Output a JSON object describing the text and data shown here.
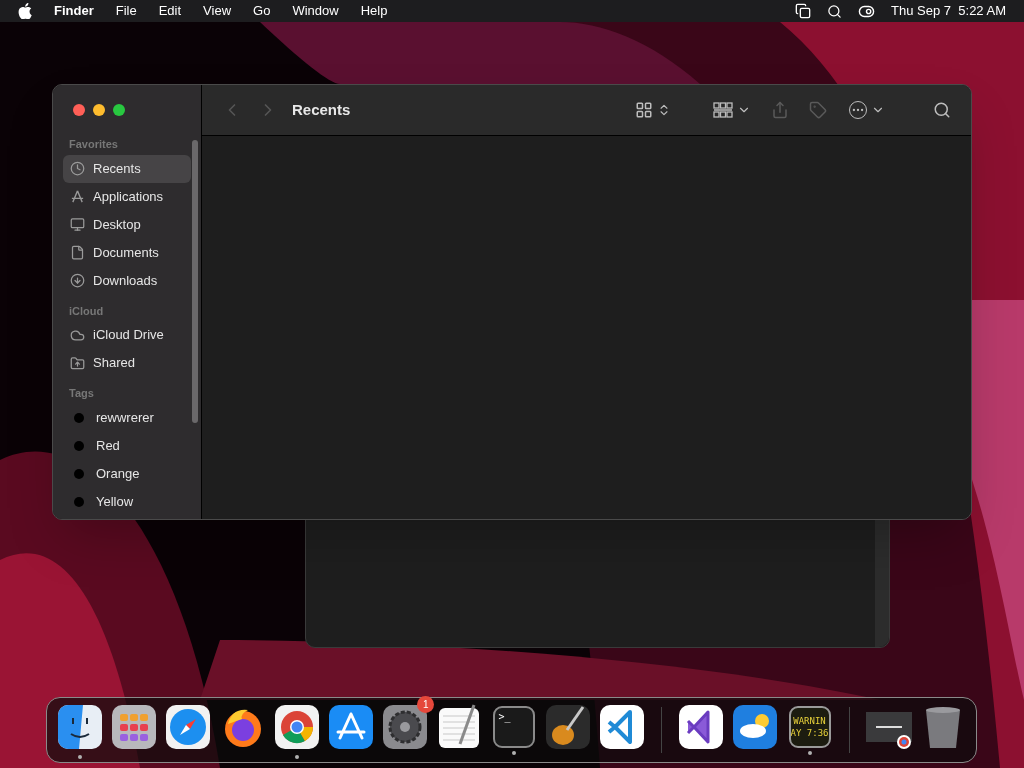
{
  "menu_bar": {
    "app_name": "Finder",
    "menus": [
      "File",
      "Edit",
      "View",
      "Go",
      "Window",
      "Help"
    ],
    "clock": "Thu Sep 7  5:22 AM"
  },
  "window": {
    "title": "Recents",
    "back_disabled": true,
    "forward_disabled": true,
    "toolbar": [
      {
        "kind": "icon-view",
        "disabled": false
      },
      {
        "kind": "group",
        "disabled": false
      },
      {
        "kind": "share",
        "disabled": true
      },
      {
        "kind": "tag",
        "disabled": true
      },
      {
        "kind": "more",
        "disabled": false
      },
      {
        "kind": "search",
        "disabled": false
      }
    ],
    "sidebar": [
      {
        "heading": "Favorites",
        "items": [
          {
            "label": "Recents",
            "kind": "clock",
            "selected": true
          },
          {
            "label": "Applications",
            "kind": "apps",
            "selected": false
          },
          {
            "label": "Desktop",
            "kind": "desktop",
            "selected": false
          },
          {
            "label": "Documents",
            "kind": "document",
            "selected": false
          },
          {
            "label": "Downloads",
            "kind": "download",
            "selected": false
          }
        ]
      },
      {
        "heading": "iCloud",
        "items": [
          {
            "label": "iCloud Drive",
            "kind": "cloud",
            "selected": false
          },
          {
            "label": "Shared",
            "kind": "shared",
            "selected": false
          }
        ]
      },
      {
        "heading": "Tags",
        "items": [
          {
            "label": "rewwrerer",
            "kind": "tag",
            "selected": false
          },
          {
            "label": "Red",
            "kind": "tag",
            "selected": false
          },
          {
            "label": "Orange",
            "kind": "tag",
            "selected": false
          },
          {
            "label": "Yellow",
            "kind": "tag",
            "selected": false
          }
        ]
      }
    ]
  },
  "dock": {
    "groups": [
      [
        {
          "kind": "finder",
          "running": true
        },
        {
          "kind": "launchpad",
          "running": false
        },
        {
          "kind": "safari",
          "running": false
        },
        {
          "kind": "firefox",
          "running": false
        },
        {
          "kind": "chrome",
          "running": true
        },
        {
          "kind": "appstore",
          "running": false
        },
        {
          "kind": "settings",
          "running": false,
          "badge": "1"
        },
        {
          "kind": "textedit",
          "running": false
        },
        {
          "kind": "terminal",
          "running": true,
          "prompt": ">_"
        },
        {
          "kind": "garageband",
          "running": false
        },
        {
          "kind": "vscode",
          "running": false
        }
      ],
      [
        {
          "kind": "visualstudio",
          "running": false
        },
        {
          "kind": "weather",
          "running": false
        },
        {
          "kind": "console",
          "running": true,
          "lines": [
            "WARNIN",
            "AY 7:36"
          ]
        }
      ],
      [
        {
          "kind": "minimized",
          "running": false
        },
        {
          "kind": "trash",
          "running": false
        }
      ]
    ]
  }
}
